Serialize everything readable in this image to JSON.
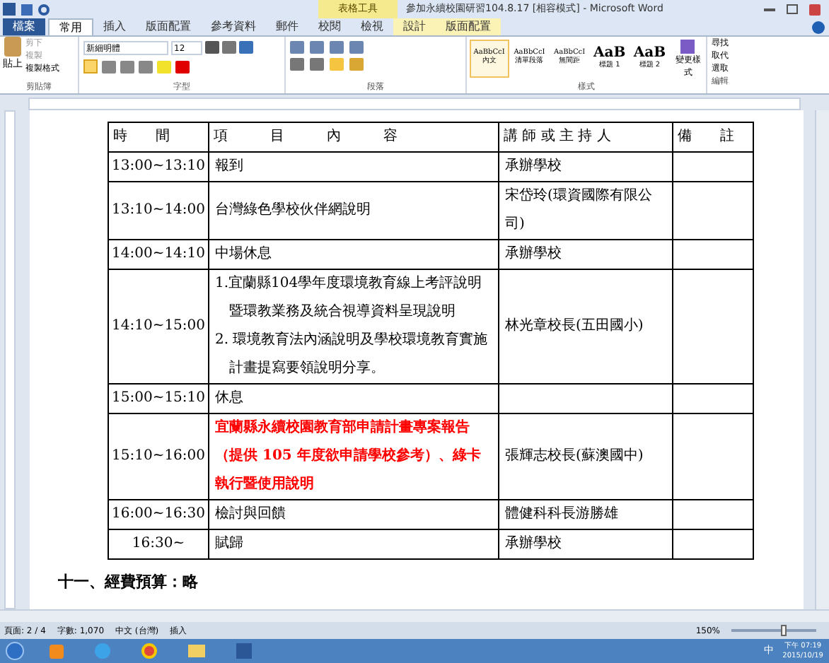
{
  "window": {
    "title": "參加永續校園研習104.8.17 [相容模式] - Microsoft Word",
    "context_tab": "表格工具"
  },
  "tabs": [
    {
      "label": "檔案",
      "kind": "file",
      "selected": false
    },
    {
      "label": "常用",
      "kind": "tab",
      "selected": true
    },
    {
      "label": "插入",
      "kind": "tab",
      "selected": false
    },
    {
      "label": "版面配置",
      "kind": "tab",
      "selected": false
    },
    {
      "label": "參考資料",
      "kind": "tab",
      "selected": false
    },
    {
      "label": "郵件",
      "kind": "tab",
      "selected": false
    },
    {
      "label": "校閱",
      "kind": "tab",
      "selected": false
    },
    {
      "label": "檢視",
      "kind": "tab",
      "selected": false
    },
    {
      "label": "設計",
      "kind": "context",
      "selected": false
    },
    {
      "label": "版面配置",
      "kind": "context",
      "selected": false
    }
  ],
  "ribbon": {
    "clipboard": {
      "label": "剪貼簿",
      "paste": "貼上",
      "cut": "剪下",
      "copy": "複製",
      "format_painter": "複製格式"
    },
    "font": {
      "label": "字型",
      "font_name": "新細明體",
      "font_size": "12"
    },
    "paragraph": {
      "label": "段落"
    },
    "styles": {
      "label": "樣式",
      "items": [
        {
          "preview": "AaBbCcI",
          "name": "內文",
          "selected": true
        },
        {
          "preview": "AaBbCcI",
          "name": "清單段落",
          "selected": false
        },
        {
          "preview": "AaBbCcI",
          "name": "無間距",
          "selected": false
        },
        {
          "preview": "AaB",
          "name": "標題 1",
          "selected": false
        },
        {
          "preview": "AaB",
          "name": "標題 2",
          "selected": false
        }
      ],
      "change": "變更樣式"
    },
    "editing": {
      "label": "編輯",
      "find": "尋找",
      "replace": "取代",
      "select": "選取"
    }
  },
  "table": {
    "columns": [
      "時　　間",
      "項　　　目　　　內　　　容",
      "講 師 或 主 持 人",
      "備　　註"
    ],
    "rows": [
      {
        "time": "13:00~13:10",
        "items": [
          "報到"
        ],
        "highlight": false,
        "speaker": "承辦學校"
      },
      {
        "time": "13:10~14:00",
        "items": [
          "台灣綠色學校伙伴網說明"
        ],
        "highlight": false,
        "speaker": "宋岱玲(環資國際有限公司)"
      },
      {
        "time": "14:00~14:10",
        "items": [
          "中場休息"
        ],
        "highlight": false,
        "speaker": "承辦學校"
      },
      {
        "time": "14:10~15:00",
        "items": [
          "1.宜蘭縣104學年度環境教育線上考評說明暨環教業務及統合視導資料呈現說明",
          "2. 環境教育法內涵說明及學校環境教育實施計畫提寫要領說明分享。"
        ],
        "highlight": false,
        "speaker": "林光章校長(五田國小)"
      },
      {
        "time": "15:00~15:10",
        "items": [
          "休息"
        ],
        "highlight": false,
        "speaker": ""
      },
      {
        "time": "15:10~16:00",
        "items": [
          "宜蘭縣永續校園教育部申請計畫專案報告（提供 105 年度欲申請學校參考）、綠卡執行暨使用說明"
        ],
        "highlight": true,
        "speaker": "張輝志校長(蘇澳國中)"
      },
      {
        "time": "16:00~16:30",
        "items": [
          "檢討與回饋"
        ],
        "highlight": false,
        "speaker": "體健科科長游勝雄"
      },
      {
        "time": "16:30~",
        "items": [
          "賦歸"
        ],
        "highlight": false,
        "speaker": "承辦學校"
      }
    ]
  },
  "after_table": "十一、經費預算：略",
  "status_bar": {
    "page": "頁面: 2 / 4",
    "words": "字數: 1,070",
    "language": "中文 (台灣)",
    "mode": "插入",
    "zoom": "150%",
    "level": 0.62
  },
  "taskbar": {
    "ime": "中",
    "time": "下午 07:19",
    "date": "2015/10/19"
  }
}
